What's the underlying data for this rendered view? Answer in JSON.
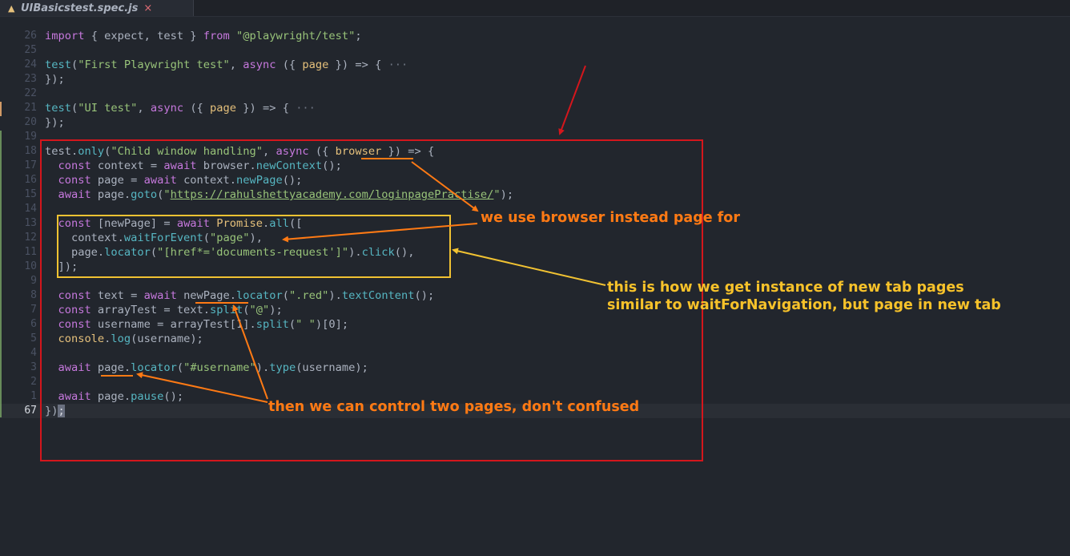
{
  "tab": {
    "icon": "flask-icon",
    "title": "UIBasicstest.spec.js",
    "close": "×"
  },
  "colors": {
    "background": "#22262d",
    "red_box": "#d4161c",
    "yellow_box": "#f1c232",
    "orange_annotation": "#ff7a14",
    "yellow_annotation": "#f7c22a"
  },
  "lines": [
    {
      "num": "26",
      "tokens": [
        [
          "k",
          "import"
        ],
        [
          "t",
          " { expect, test } "
        ],
        [
          "k",
          "from"
        ],
        [
          "t",
          " "
        ],
        [
          "s",
          "\"@playwright/test\""
        ],
        [
          "t",
          ";"
        ]
      ]
    },
    {
      "num": "25",
      "tokens": []
    },
    {
      "num": "24",
      "tokens": [
        [
          "f",
          "test"
        ],
        [
          "t",
          "("
        ],
        [
          "s",
          "\"First Playwright test\""
        ],
        [
          "t",
          ", "
        ],
        [
          "k",
          "async"
        ],
        [
          "t",
          " ({ "
        ],
        [
          "p",
          "page"
        ],
        [
          "t",
          " }) => { "
        ],
        [
          "dim",
          "···"
        ]
      ]
    },
    {
      "num": "23",
      "tokens": [
        [
          "t",
          "});"
        ]
      ]
    },
    {
      "num": "22",
      "tokens": []
    },
    {
      "num": "21",
      "tokens": [
        [
          "f",
          "test"
        ],
        [
          "t",
          "("
        ],
        [
          "s",
          "\"UI test\""
        ],
        [
          "t",
          ", "
        ],
        [
          "k",
          "async"
        ],
        [
          "t",
          " ({ "
        ],
        [
          "p",
          "page"
        ],
        [
          "t",
          " }) => { "
        ],
        [
          "dim",
          "···"
        ]
      ]
    },
    {
      "num": "20",
      "tokens": [
        [
          "t",
          "});"
        ]
      ]
    },
    {
      "num": "19",
      "tokens": []
    },
    {
      "num": "18",
      "tokens": [
        [
          "t",
          "test."
        ],
        [
          "f",
          "only"
        ],
        [
          "t",
          "("
        ],
        [
          "s",
          "\"Child window handling\""
        ],
        [
          "t",
          ", "
        ],
        [
          "k",
          "async"
        ],
        [
          "t",
          " ({ "
        ],
        [
          "p",
          "browser"
        ],
        [
          "t",
          " }) => {"
        ]
      ]
    },
    {
      "num": "17",
      "tokens": [
        [
          "t",
          "  "
        ],
        [
          "k",
          "const"
        ],
        [
          "t",
          " context = "
        ],
        [
          "k",
          "await"
        ],
        [
          "t",
          " browser."
        ],
        [
          "f",
          "newContext"
        ],
        [
          "t",
          "();"
        ]
      ]
    },
    {
      "num": "16",
      "tokens": [
        [
          "t",
          "  "
        ],
        [
          "k",
          "const"
        ],
        [
          "t",
          " page = "
        ],
        [
          "k",
          "await"
        ],
        [
          "t",
          " context."
        ],
        [
          "f",
          "newPage"
        ],
        [
          "t",
          "();"
        ]
      ]
    },
    {
      "num": "15",
      "tokens": [
        [
          "t",
          "  "
        ],
        [
          "k",
          "await"
        ],
        [
          "t",
          " page."
        ],
        [
          "f",
          "goto"
        ],
        [
          "t",
          "("
        ],
        [
          "s",
          "\""
        ],
        [
          "su",
          "https://rahulshettyacademy.com/loginpagePractise/"
        ],
        [
          "s",
          "\""
        ],
        [
          "t",
          ");"
        ]
      ]
    },
    {
      "num": "14",
      "tokens": []
    },
    {
      "num": "13",
      "tokens": [
        [
          "t",
          "  "
        ],
        [
          "k",
          "const"
        ],
        [
          "t",
          " [newPage] = "
        ],
        [
          "k",
          "await"
        ],
        [
          "t",
          " "
        ],
        [
          "p",
          "Promise"
        ],
        [
          "t",
          "."
        ],
        [
          "f",
          "all"
        ],
        [
          "t",
          "(["
        ]
      ]
    },
    {
      "num": "12",
      "tokens": [
        [
          "t",
          "    context."
        ],
        [
          "f",
          "waitForEvent"
        ],
        [
          "t",
          "("
        ],
        [
          "s",
          "\"page\""
        ],
        [
          "t",
          "),"
        ]
      ]
    },
    {
      "num": "11",
      "tokens": [
        [
          "t",
          "    page."
        ],
        [
          "f",
          "locator"
        ],
        [
          "t",
          "("
        ],
        [
          "s",
          "\"[href*='documents-request']\""
        ],
        [
          "t",
          ")."
        ],
        [
          "f",
          "click"
        ],
        [
          "t",
          "(),"
        ]
      ]
    },
    {
      "num": "10",
      "tokens": [
        [
          "t",
          "  ]);"
        ]
      ]
    },
    {
      "num": "9",
      "tokens": []
    },
    {
      "num": "8",
      "tokens": [
        [
          "t",
          "  "
        ],
        [
          "k",
          "const"
        ],
        [
          "t",
          " text = "
        ],
        [
          "k",
          "await"
        ],
        [
          "t",
          " newPage."
        ],
        [
          "f",
          "locator"
        ],
        [
          "t",
          "("
        ],
        [
          "s",
          "\".red\""
        ],
        [
          "t",
          ")."
        ],
        [
          "f",
          "textContent"
        ],
        [
          "t",
          "();"
        ]
      ]
    },
    {
      "num": "7",
      "tokens": [
        [
          "t",
          "  "
        ],
        [
          "k",
          "const"
        ],
        [
          "t",
          " arrayTest = text."
        ],
        [
          "f",
          "split"
        ],
        [
          "t",
          "("
        ],
        [
          "s",
          "\"@\""
        ],
        [
          "t",
          ");"
        ]
      ]
    },
    {
      "num": "6",
      "tokens": [
        [
          "t",
          "  "
        ],
        [
          "k",
          "const"
        ],
        [
          "t",
          " username = arrayTest[1]."
        ],
        [
          "f",
          "split"
        ],
        [
          "t",
          "("
        ],
        [
          "s",
          "\" \""
        ],
        [
          "t",
          ")[0];"
        ]
      ]
    },
    {
      "num": "5",
      "tokens": [
        [
          "t",
          "  "
        ],
        [
          "p",
          "console"
        ],
        [
          "t",
          "."
        ],
        [
          "f",
          "log"
        ],
        [
          "t",
          "(username);"
        ]
      ]
    },
    {
      "num": "4",
      "tokens": []
    },
    {
      "num": "3",
      "tokens": [
        [
          "t",
          "  "
        ],
        [
          "k",
          "await"
        ],
        [
          "t",
          " page."
        ],
        [
          "f",
          "locator"
        ],
        [
          "t",
          "("
        ],
        [
          "s",
          "\"#username\""
        ],
        [
          "t",
          ")."
        ],
        [
          "f",
          "type"
        ],
        [
          "t",
          "(username);"
        ]
      ]
    },
    {
      "num": "2",
      "tokens": []
    },
    {
      "num": "1",
      "tokens": [
        [
          "t",
          "  "
        ],
        [
          "k",
          "await"
        ],
        [
          "t",
          " page."
        ],
        [
          "f",
          "pause"
        ],
        [
          "t",
          "();"
        ]
      ]
    },
    {
      "num": "67",
      "current": true,
      "tokens": [
        [
          "t",
          "})"
        ],
        [
          "caret",
          ";"
        ]
      ]
    }
  ],
  "annotations": {
    "browser_note": "we use browser instead page for",
    "instance_note_1": "this is how we get instance of new tab pages",
    "instance_note_2": "similar to waitForNavigation, but page in new tab",
    "control_note": "then we can control two pages, don't confused"
  }
}
